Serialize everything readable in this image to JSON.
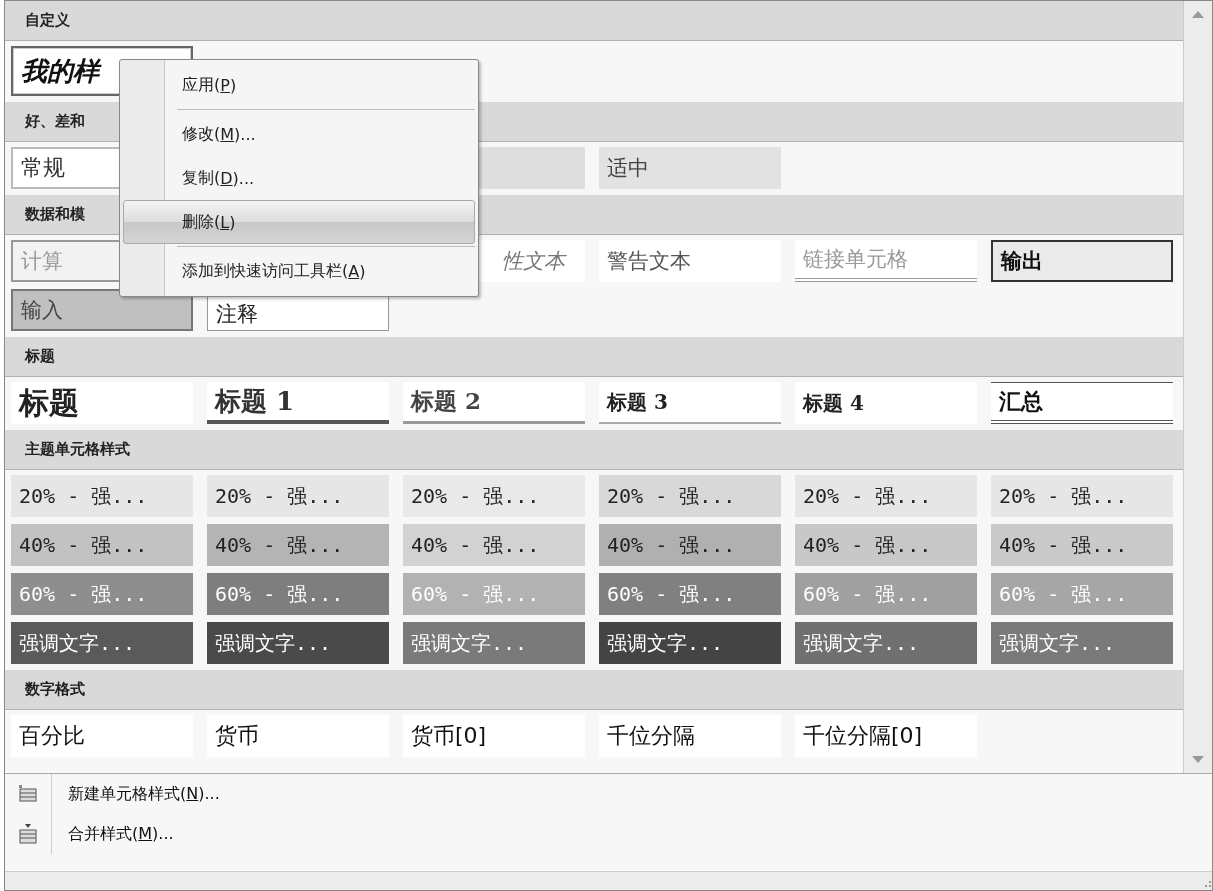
{
  "gallery": {
    "sections": [
      {
        "title": "自定义",
        "rows": [
          [
            {
              "kind": "custom",
              "label": "我的样"
            }
          ]
        ]
      },
      {
        "title": "好、差和",
        "rows": [
          [
            {
              "kind": "normal",
              "label": "常规"
            },
            {
              "kind": "bad"
            },
            {
              "kind": "good"
            },
            {
              "kind": "neutral",
              "label": "适中"
            }
          ]
        ]
      },
      {
        "title": "数据和模",
        "rows": [
          [
            {
              "kind": "calc",
              "label": "计算"
            },
            {
              "kind": "check"
            },
            {
              "kind": "explanatory",
              "label": "性文本"
            },
            {
              "kind": "warning",
              "label": "警告文本"
            },
            {
              "kind": "linked",
              "label": "链接单元格"
            },
            {
              "kind": "output",
              "label": "输出"
            }
          ],
          [
            {
              "kind": "input",
              "label": "输入"
            },
            {
              "kind": "note",
              "label": "注释"
            }
          ]
        ]
      },
      {
        "title": "标题",
        "rows": [
          [
            {
              "kind": "title",
              "label": "标题"
            },
            {
              "kind": "heading1",
              "label": "标题 1"
            },
            {
              "kind": "heading2",
              "label": "标题 2"
            },
            {
              "kind": "heading3",
              "label": "标题 3"
            },
            {
              "kind": "heading4",
              "label": "标题 4"
            },
            {
              "kind": "total",
              "label": "汇总"
            }
          ]
        ]
      },
      {
        "title": "主题单元格样式",
        "rows": [
          [
            {
              "kind": "accent-light",
              "label": "20% - 强...",
              "color": "#e6e6e6"
            },
            {
              "kind": "accent-light",
              "label": "20% - 强...",
              "color": "#e6e6e6"
            },
            {
              "kind": "accent-light",
              "label": "20% - 强...",
              "color": "#e9e9e9"
            },
            {
              "kind": "accent-light",
              "label": "20% - 强...",
              "color": "#d8d8d8"
            },
            {
              "kind": "accent-light",
              "label": "20% - 强...",
              "color": "#e6e6e6"
            },
            {
              "kind": "accent-light",
              "label": "20% - 强...",
              "color": "#e6e6e6"
            }
          ],
          [
            {
              "kind": "accent-light",
              "label": "40% - 强...",
              "color": "#c2c2c2"
            },
            {
              "kind": "accent-light",
              "label": "40% - 强...",
              "color": "#b4b4b4"
            },
            {
              "kind": "accent-light",
              "label": "40% - 强...",
              "color": "#d2d2d2"
            },
            {
              "kind": "accent-light",
              "label": "40% - 强...",
              "color": "#b0b0b0"
            },
            {
              "kind": "accent-light",
              "label": "40% - 强...",
              "color": "#c8c8c8"
            },
            {
              "kind": "accent-light",
              "label": "40% - 强...",
              "color": "#cacaca"
            }
          ],
          [
            {
              "kind": "accent-dark",
              "label": "60% - 强...",
              "color": "#8e8e8e"
            },
            {
              "kind": "accent-dark",
              "label": "60% - 强...",
              "color": "#7e7e7e"
            },
            {
              "kind": "accent-dark",
              "label": "60% - 强...",
              "color": "#b2b2b2"
            },
            {
              "kind": "accent-dark",
              "label": "60% - 强...",
              "color": "#808080"
            },
            {
              "kind": "accent-dark",
              "label": "60% - 强...",
              "color": "#a0a0a0"
            },
            {
              "kind": "accent-dark",
              "label": "60% - 强...",
              "color": "#a6a6a6"
            }
          ],
          [
            {
              "kind": "accent-dark",
              "label": "强调文字...",
              "color": "#5a5a5a"
            },
            {
              "kind": "accent-dark",
              "label": "强调文字...",
              "color": "#4a4a4a"
            },
            {
              "kind": "accent-dark",
              "label": "强调文字...",
              "color": "#7a7a7a"
            },
            {
              "kind": "accent-dark",
              "label": "强调文字...",
              "color": "#444444"
            },
            {
              "kind": "accent-dark",
              "label": "强调文字...",
              "color": "#707070"
            },
            {
              "kind": "accent-dark",
              "label": "强调文字...",
              "color": "#7a7a7a"
            }
          ]
        ]
      },
      {
        "title": "数字格式",
        "rows": [
          [
            {
              "kind": "number",
              "label": "百分比"
            },
            {
              "kind": "number",
              "label": "货币"
            },
            {
              "kind": "number",
              "label": "货币[0]"
            },
            {
              "kind": "number",
              "label": "千位分隔"
            },
            {
              "kind": "number",
              "label": "千位分隔[0]"
            }
          ]
        ]
      }
    ]
  },
  "footer_items": [
    {
      "kind": "new",
      "before": "新建单元格样式(",
      "key": "N",
      "after": ")..."
    },
    {
      "kind": "merge",
      "before": "合并样式(",
      "key": "M",
      "after": ")..."
    }
  ],
  "context_menu": [
    {
      "kind": "item",
      "before": "应用(",
      "key": "P",
      "after": ")",
      "selected": false
    },
    {
      "kind": "separator"
    },
    {
      "kind": "item",
      "before": "修改(",
      "key": "M",
      "after": ")...",
      "selected": false
    },
    {
      "kind": "item",
      "before": "复制(",
      "key": "D",
      "after": ")...",
      "selected": false
    },
    {
      "kind": "item",
      "before": "删除(",
      "key": "L",
      "after": ")",
      "selected": true
    },
    {
      "kind": "separator"
    },
    {
      "kind": "item",
      "before": "添加到快速访问工具栏(",
      "key": "A",
      "after": ")",
      "selected": false
    }
  ]
}
